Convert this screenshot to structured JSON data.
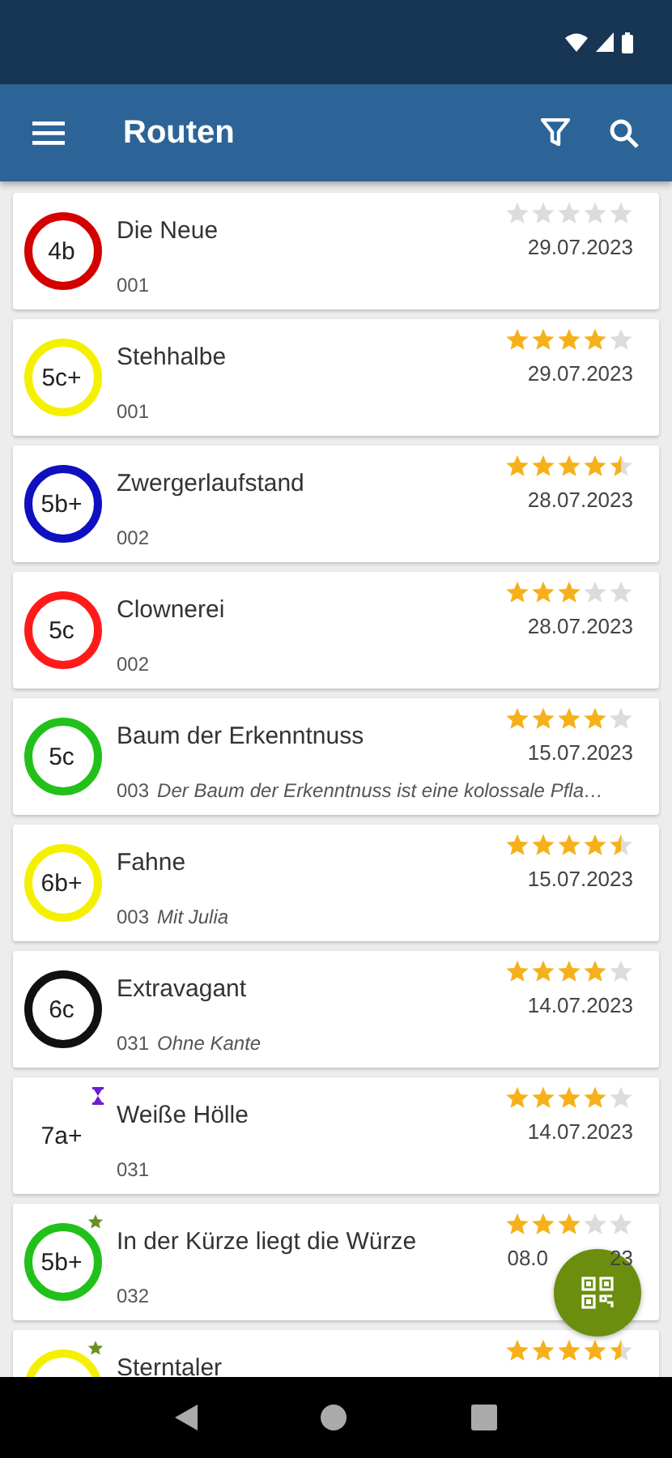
{
  "app_bar": {
    "title": "Routen"
  },
  "routes": [
    {
      "grade": "4b",
      "color": "#d40000",
      "starred": false,
      "in_progress": false,
      "name": "Die Neue",
      "number": "001",
      "stars": 0,
      "date": "29.07.2023"
    },
    {
      "grade": "5c+",
      "color": "#f5f000",
      "starred": false,
      "in_progress": false,
      "name": "Stehhalbe",
      "number": "001",
      "stars": 4,
      "date": "29.07.2023"
    },
    {
      "grade": "5b+",
      "color": "#1010c0",
      "starred": false,
      "in_progress": false,
      "name": "Zwergerlaufstand",
      "number": "002",
      "stars": 4.5,
      "date": "28.07.2023"
    },
    {
      "grade": "5c",
      "color": "#ff1a1a",
      "starred": false,
      "in_progress": false,
      "name": "Clownerei",
      "number": "002",
      "stars": 3,
      "date": "28.07.2023"
    },
    {
      "grade": "5c",
      "color": "#22c01a",
      "starred": false,
      "in_progress": false,
      "name": "Baum der Erkenntnuss",
      "number": "003",
      "note": "Der Baum der Erkenntnuss ist eine kolossale Pfla…",
      "stars": 4,
      "date": "15.07.2023"
    },
    {
      "grade": "6b+",
      "color": "#f5f000",
      "starred": false,
      "in_progress": false,
      "name": "Fahne",
      "number": "003",
      "note": "Mit Julia",
      "stars": 4.5,
      "date": "15.07.2023"
    },
    {
      "grade": "6c",
      "color": "#111111",
      "starred": false,
      "in_progress": false,
      "name": "Extravagant",
      "number": "031",
      "note": "Ohne Kante",
      "stars": 4,
      "date": "14.07.2023"
    },
    {
      "grade": "7a+",
      "starred": false,
      "in_progress": true,
      "name": "Weiße Hölle",
      "number": "031",
      "stars": 4,
      "date": "14.07.2023"
    },
    {
      "grade": "5b+",
      "color": "#22c01a",
      "starred": true,
      "in_progress": false,
      "name": "In der Kürze liegt die Würze",
      "number": "032",
      "stars": 3,
      "date": "08.0",
      "date_tail": "23"
    },
    {
      "color": "#f5f000",
      "starred": true,
      "in_progress": false,
      "name": "Sterntaler",
      "stars": 4.5
    }
  ]
}
